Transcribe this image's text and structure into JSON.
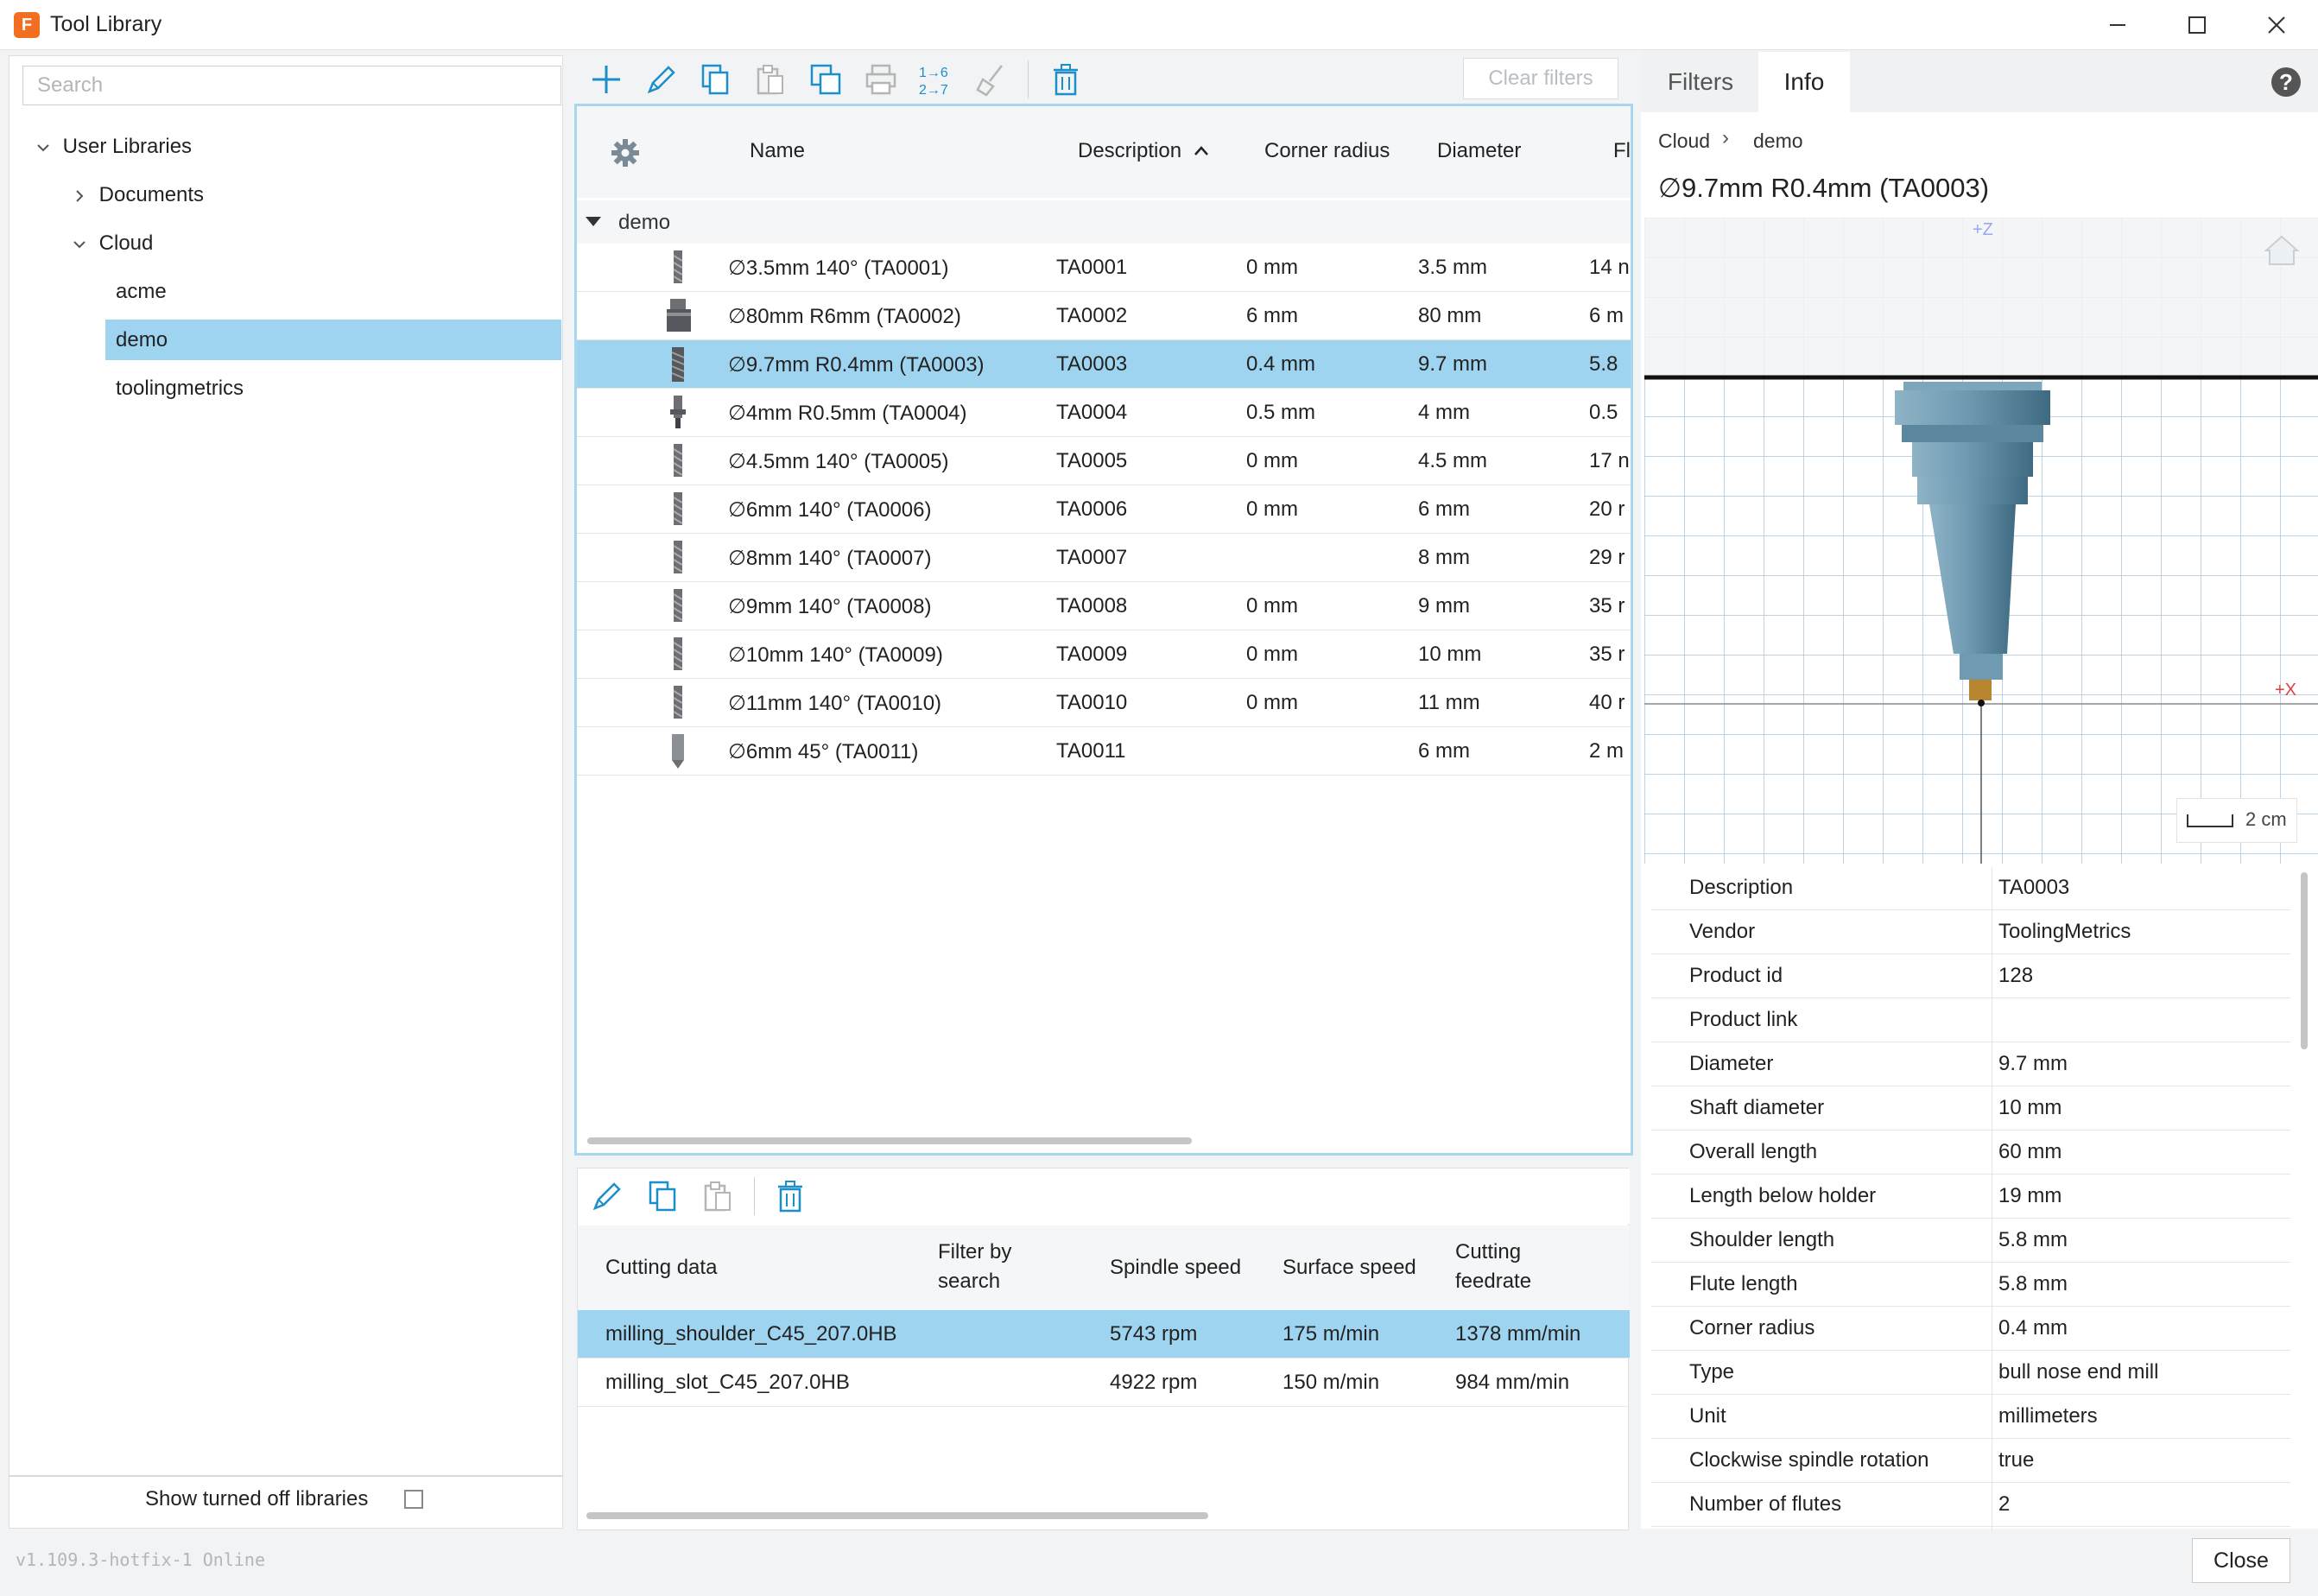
{
  "window": {
    "title": "Tool Library",
    "app_icon_letter": "F"
  },
  "left": {
    "search_placeholder": "Search",
    "tree": {
      "root": "User Libraries",
      "documents": "Documents",
      "cloud": "Cloud",
      "children": [
        "acme",
        "demo",
        "toolingmetrics"
      ]
    },
    "show_turned_off": "Show turned off libraries"
  },
  "toolbar": {
    "clear_filters": "Clear filters"
  },
  "tool_table": {
    "columns": [
      "Name",
      "Description",
      "Corner radius",
      "Diameter",
      "Fl"
    ],
    "group": "demo",
    "rows": [
      {
        "name": "∅3.5mm 140° (TA0001)",
        "description": "TA0001",
        "corner_radius": "0 mm",
        "diameter": "3.5 mm",
        "fl": "14 n"
      },
      {
        "name": "∅80mm R6mm (TA0002)",
        "description": "TA0002",
        "corner_radius": "6 mm",
        "diameter": "80 mm",
        "fl": "6 m"
      },
      {
        "name": "∅9.7mm R0.4mm (TA0003)",
        "description": "TA0003",
        "corner_radius": "0.4 mm",
        "diameter": "9.7 mm",
        "fl": "5.8"
      },
      {
        "name": "∅4mm R0.5mm (TA0004)",
        "description": "TA0004",
        "corner_radius": "0.5 mm",
        "diameter": "4 mm",
        "fl": "0.5"
      },
      {
        "name": "∅4.5mm 140° (TA0005)",
        "description": "TA0005",
        "corner_radius": "0 mm",
        "diameter": "4.5 mm",
        "fl": "17 n"
      },
      {
        "name": "∅6mm 140° (TA0006)",
        "description": "TA0006",
        "corner_radius": "0 mm",
        "diameter": "6 mm",
        "fl": "20 r"
      },
      {
        "name": "∅8mm 140° (TA0007)",
        "description": "TA0007",
        "corner_radius": "",
        "diameter": "8 mm",
        "fl": "29 r"
      },
      {
        "name": "∅9mm 140° (TA0008)",
        "description": "TA0008",
        "corner_radius": "0 mm",
        "diameter": "9 mm",
        "fl": "35 r"
      },
      {
        "name": "∅10mm 140° (TA0009)",
        "description": "TA0009",
        "corner_radius": "0 mm",
        "diameter": "10 mm",
        "fl": "35 r"
      },
      {
        "name": "∅11mm 140° (TA0010)",
        "description": "TA0010",
        "corner_radius": "0 mm",
        "diameter": "11 mm",
        "fl": "40 r"
      },
      {
        "name": "∅6mm 45° (TA0011)",
        "description": "TA0011",
        "corner_radius": "",
        "diameter": "6 mm",
        "fl": "2 m"
      }
    ]
  },
  "cutting": {
    "columns": [
      "Cutting data",
      "Filter by search",
      "Spindle speed",
      "Surface speed",
      "Cutting feedrate"
    ],
    "rows": [
      {
        "name": "milling_shoulder_C45_207.0HB",
        "spindle": "5743 rpm",
        "surface": "175 m/min",
        "feed": "1378 mm/min"
      },
      {
        "name": "milling_slot_C45_207.0HB",
        "spindle": "4922 rpm",
        "surface": "150 m/min",
        "feed": "984 mm/min"
      }
    ]
  },
  "right": {
    "tabs": [
      "Filters",
      "Info"
    ],
    "breadcrumb": [
      "Cloud",
      "demo"
    ],
    "title": "∅9.7mm R0.4mm (TA0003)",
    "viewer": {
      "axis_z": "+Z",
      "axis_x": "+X",
      "scale": "2 cm"
    },
    "properties": [
      {
        "key": "Description",
        "value": "TA0003"
      },
      {
        "key": "Vendor",
        "value": "ToolingMetrics"
      },
      {
        "key": "Product id",
        "value": "128"
      },
      {
        "key": "Product link",
        "value": ""
      },
      {
        "key": "Diameter",
        "value": "9.7 mm"
      },
      {
        "key": "Shaft diameter",
        "value": "10 mm"
      },
      {
        "key": "Overall length",
        "value": "60 mm"
      },
      {
        "key": "Length below holder",
        "value": "19 mm"
      },
      {
        "key": "Shoulder length",
        "value": "5.8 mm"
      },
      {
        "key": "Flute length",
        "value": "5.8 mm"
      },
      {
        "key": "Corner radius",
        "value": "0.4 mm"
      },
      {
        "key": "Type",
        "value": "bull nose end mill"
      },
      {
        "key": "Unit",
        "value": "millimeters"
      },
      {
        "key": "Clockwise spindle rotation",
        "value": "true"
      },
      {
        "key": "Number of flutes",
        "value": "2"
      }
    ]
  },
  "footer": {
    "version": "v1.109.3-hotfix-1 Online",
    "close": "Close"
  },
  "colors": {
    "accent": "#1a8fc9",
    "selection": "#9fd4f0",
    "brand": "#f26f21"
  }
}
